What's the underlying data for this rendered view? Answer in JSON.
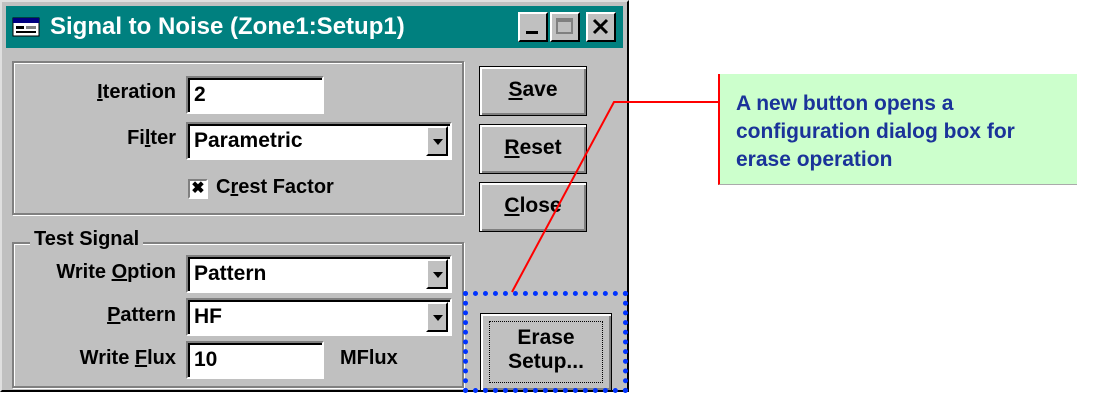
{
  "window": {
    "title": "Signal to Noise (Zone1:Setup1)",
    "controls": [
      "minimize",
      "maximize",
      "close"
    ]
  },
  "params": {
    "iteration_label_pre": "",
    "iteration_label_mn": "I",
    "iteration_label_post": "teration",
    "iteration_value": "2",
    "filter_label_pre": "Fi",
    "filter_label_mn": "l",
    "filter_label_post": "ter",
    "filter_value": "Parametric",
    "crest_pre": "C",
    "crest_mn": "r",
    "crest_post": "est Factor",
    "crest_checked": "✖"
  },
  "test_signal": {
    "group_label": "Test Signal",
    "write_option_pre": "Write ",
    "write_option_mn": "O",
    "write_option_post": "ption",
    "write_option_value": "Pattern",
    "pattern_pre": "",
    "pattern_mn": "P",
    "pattern_post": "attern",
    "pattern_value": "HF",
    "write_flux_pre": "Write ",
    "write_flux_mn": "F",
    "write_flux_post": "lux",
    "write_flux_value": "10",
    "write_flux_unit": "MFlux"
  },
  "buttons": {
    "save_mn": "S",
    "save_rest": "ave",
    "reset_mn": "R",
    "reset_rest": "eset",
    "close_mn": "C",
    "close_rest": "lose",
    "erase_line1": "Erase",
    "erase_line2": "Setup..."
  },
  "callout": {
    "text": "A new button opens a configuration dialog box for erase operation"
  },
  "colors": {
    "titlebar": "#00807f",
    "window": "#c0c0c0",
    "highlight": "#0033ff",
    "callout_bg": "#ccffcc",
    "callout_text": "#1a3399",
    "pointer": "#ff0000"
  }
}
